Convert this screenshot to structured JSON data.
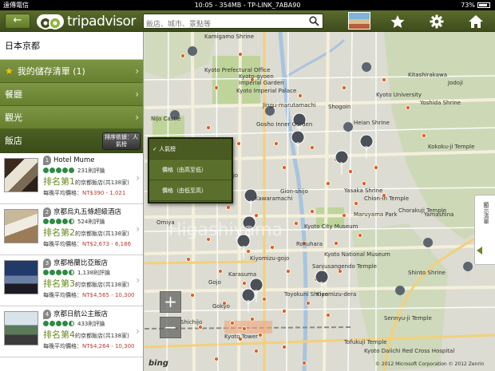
{
  "status_bar": {
    "carrier": "遠傳電信",
    "center": "10:05 - 354MB - TP-LINK_7ABA90",
    "battery": "73%"
  },
  "header": {
    "back_label": "←",
    "logo_text": "tripadvisor",
    "search_placeholder": "飯店、城市、景點等",
    "icons": [
      "star-icon",
      "gear-icon",
      "home-icon"
    ]
  },
  "sidebar": {
    "location": "日本京都",
    "nav": [
      {
        "label": "我的儲存清單 (1)",
        "icon": "star-icon"
      },
      {
        "label": "餐廳"
      },
      {
        "label": "觀光"
      }
    ],
    "section_title": "飯店",
    "sort_button": "排序依據：人氣榜",
    "hotels": [
      {
        "number": "1",
        "name": "Hotel Mume",
        "reviews": "231則評論",
        "rank_label": "排名第1",
        "rank_suffix": "的京都飯店(共138家)",
        "price_label": "每晚平均價格：",
        "price": "NT$390 - 1,021",
        "stars": 5
      },
      {
        "number": "2",
        "name": "京都烏丸五條超級酒店",
        "reviews": "524則評論",
        "rank_label": "排名第2",
        "rank_suffix": "的京都飯店(共138家)",
        "price_label": "每晚平均價格：",
        "price": "NT$2,673 - 6,186",
        "stars": 4.5
      },
      {
        "number": "3",
        "name": "京都格蘭比亞飯店",
        "reviews": "1,138則評論",
        "rank_label": "排名第3",
        "rank_suffix": "的京都飯店(共138家)",
        "price_label": "每晚平均價格：",
        "price": "NT$4,565 - 10,300",
        "stars": 4.5
      },
      {
        "number": "4",
        "name": "京都日航公主飯店",
        "reviews": "433則評論",
        "rank_label": "排名第4",
        "rank_suffix": "的京都飯店(共138家)",
        "price_label": "每晚平均價格：",
        "price": "NT$4,264 - 10,300",
        "stars": 4.5
      }
    ]
  },
  "sort_menu": {
    "options": [
      "✓ 人氣榜",
      "價格（由高至低）",
      "價格（由低至高）"
    ]
  },
  "map": {
    "labels": [
      "Kamigamo Shrine",
      "Kyoto-gyoen",
      "Imperial Garden",
      "Kyoto Imperial Palace",
      "Kyoto Prefectural Office",
      "Nijo Castle",
      "Jingu-marutamachi",
      "Gosho Inner Garden",
      "Heian Shrine",
      "Kawaramachi",
      "Gion-shijo",
      "Kiyomizu-gojo",
      "Yasaka Shrine",
      "Maruyama Park",
      "Chion-in Temple",
      "Chorakuji Temple",
      "Kyoto City Museum",
      "Kyoto National Museum",
      "Sanjusangendo Temple",
      "Tofukuji Temple",
      "Yoshida Shrine",
      "Kokoku-ji Temple",
      "Higashiyama",
      "Yamashina",
      "Sennyu-ji Temple",
      "Shinto Shrine",
      "Toyokuni Shrine",
      "Kiyomizu-dera",
      "Kyoto Daiichi Red Cross Hospital",
      "Kyoto Tower",
      "Shijo",
      "Karasuma",
      "Omiya",
      "Gojo",
      "Shichijo",
      "Shogoin",
      "Kitashirakawa",
      "Jodoji",
      "Rokuhara",
      "Gokyo",
      "Kyoto University"
    ],
    "copyright": "© 2012 Microsoft Corporation  © 2012 Zenrin",
    "bing": "bing",
    "side_tab": "顯示清單",
    "zoom_in": "+",
    "zoom_out": "−",
    "pin_numbers": [
      "10",
      "6",
      "9",
      "1",
      "4",
      "2",
      "7",
      "8",
      "3",
      "5"
    ]
  }
}
